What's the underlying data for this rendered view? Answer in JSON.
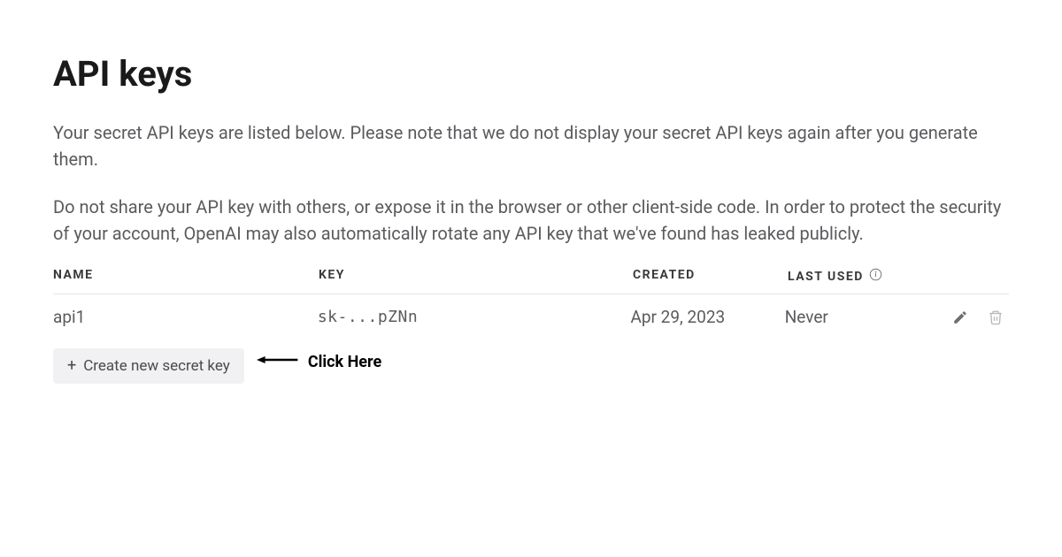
{
  "page": {
    "title": "API keys",
    "description1": "Your secret API keys are listed below. Please note that we do not display your secret API keys again after you generate them.",
    "description2": "Do not share your API key with others, or expose it in the browser or other client-side code. In order to protect the security of your account, OpenAI may also automatically rotate any API key that we've found has leaked publicly."
  },
  "table": {
    "headers": {
      "name": "NAME",
      "key": "KEY",
      "created": "CREATED",
      "last_used": "LAST USED"
    },
    "rows": [
      {
        "name": "api1",
        "key": "sk-...pZNn",
        "created": "Apr 29, 2023",
        "last_used": "Never"
      }
    ]
  },
  "actions": {
    "create_label": "Create new secret key"
  },
  "annotation": {
    "text": "Click Here"
  }
}
